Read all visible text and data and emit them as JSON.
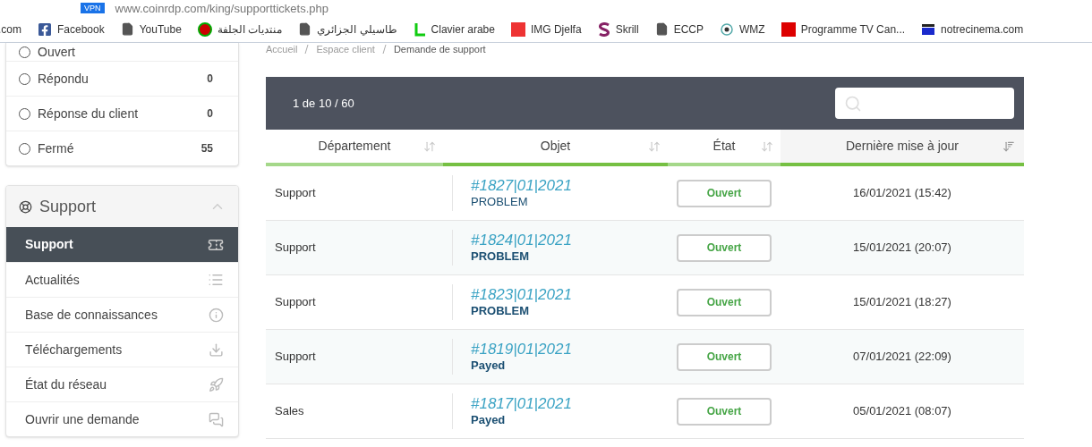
{
  "browser": {
    "url": "www.coinrdp.com/king/supporttickets.php",
    "vpn_badge": "VPN"
  },
  "bookmarks": [
    {
      "label": ".com",
      "kind": "none"
    },
    {
      "label": "Facebook",
      "kind": "facebook"
    },
    {
      "label": "YouTube",
      "kind": "page"
    },
    {
      "label": "منتديات الجلفة",
      "kind": "round"
    },
    {
      "label": "طاسيلي الجزائري",
      "kind": "page"
    },
    {
      "label": "Clavier arabe",
      "kind": "letter"
    },
    {
      "label": "IMG Djelfa",
      "kind": "red"
    },
    {
      "label": "Skrill",
      "kind": "skrill"
    },
    {
      "label": "ECCP",
      "kind": "page"
    },
    {
      "label": "WMZ",
      "kind": "globe"
    },
    {
      "label": "Programme TV Can...",
      "kind": "tl"
    },
    {
      "label": "notrecinema.com",
      "kind": "clapper"
    }
  ],
  "breadcrumb": [
    "Accueil",
    "Espace client",
    "Demande de support"
  ],
  "status_filters": [
    {
      "label": "Ouvert",
      "checked": false
    },
    {
      "label": "Répondu",
      "count": "0",
      "checked": false
    },
    {
      "label": "Réponse du client",
      "count": "0",
      "checked": false
    },
    {
      "label": "Fermé",
      "count": "55",
      "checked": false
    }
  ],
  "support_panel": {
    "title": "Support",
    "expanded": true,
    "items": [
      {
        "label": "Support",
        "kind": "ticket",
        "selected": true
      },
      {
        "label": "Actualités",
        "kind": "list",
        "selected": false
      },
      {
        "label": "Base de connaissances",
        "kind": "info",
        "selected": false
      },
      {
        "label": "Téléchargements",
        "kind": "download",
        "selected": false
      },
      {
        "label": "État du réseau",
        "kind": "rocket",
        "selected": false
      },
      {
        "label": "Ouvrir une demande",
        "kind": "chat",
        "selected": false
      }
    ]
  },
  "table": {
    "pagination": "1 de 10 / 60",
    "columns": [
      {
        "label": "Département",
        "selected": false,
        "color": "#a5d88a"
      },
      {
        "label": "Objet",
        "selected": false,
        "color": "#76c043"
      },
      {
        "label": "État",
        "selected": false,
        "color": "#a5d88a"
      },
      {
        "label": "Dernière mise à jour",
        "selected": true,
        "color": "#76c043"
      }
    ],
    "rows": [
      {
        "department": "Support",
        "ticket": "#1827|01|2021",
        "subject": "PROBLEM",
        "unread": false,
        "status": "Ouvert",
        "updated": "16/01/2021 (15:42)"
      },
      {
        "department": "Support",
        "ticket": "#1824|01|2021",
        "subject": "PROBLEM",
        "unread": true,
        "status": "Ouvert",
        "updated": "15/01/2021 (20:07)"
      },
      {
        "department": "Support",
        "ticket": "#1823|01|2021",
        "subject": "PROBLEM",
        "unread": true,
        "status": "Ouvert",
        "updated": "15/01/2021 (18:27)"
      },
      {
        "department": "Support",
        "ticket": "#1819|01|2021",
        "subject": "Payed",
        "unread": true,
        "status": "Ouvert",
        "updated": "07/01/2021 (22:09)"
      },
      {
        "department": "Sales",
        "ticket": "#1817|01|2021",
        "subject": "Payed",
        "unread": true,
        "status": "Ouvert",
        "updated": "05/01/2021 (08:07)"
      }
    ]
  }
}
